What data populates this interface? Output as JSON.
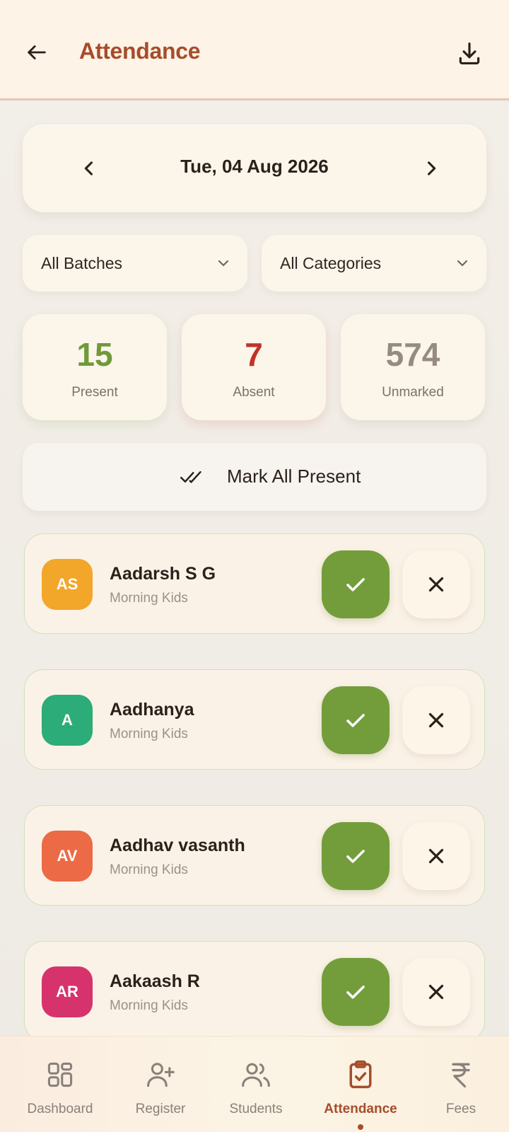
{
  "header": {
    "title": "Attendance"
  },
  "date_selector": {
    "date": "Tue, 04 Aug 2026"
  },
  "filters": {
    "batch": "All Batches",
    "category": "All Categories"
  },
  "stats": {
    "present": {
      "count": "15",
      "label": "Present"
    },
    "absent": {
      "count": "7",
      "label": "Absent"
    },
    "unmarked": {
      "count": "574",
      "label": "Unmarked"
    }
  },
  "mark_all": {
    "label": "Mark All Present"
  },
  "students": [
    {
      "initials": "AS",
      "name": "Aadarsh S G",
      "batch": "Morning Kids",
      "avatar_color": "#f2a62a",
      "status": "present"
    },
    {
      "initials": "A",
      "name": "Aadhanya",
      "batch": "Morning Kids",
      "avatar_color": "#2bac78",
      "status": "present"
    },
    {
      "initials": "AV",
      "name": "Aadhav vasanth",
      "batch": "Morning Kids",
      "avatar_color": "#ec6a45",
      "status": "present"
    },
    {
      "initials": "AR",
      "name": "Aakaash R",
      "batch": "Morning Kids",
      "avatar_color": "#d6336c",
      "status": "present"
    }
  ],
  "bottom_nav": {
    "items": [
      {
        "label": "Dashboard",
        "icon": "dashboard-grid-icon"
      },
      {
        "label": "Register",
        "icon": "user-plus-icon"
      },
      {
        "label": "Students",
        "icon": "users-icon"
      },
      {
        "label": "Attendance",
        "icon": "clipboard-check-icon",
        "active": true
      },
      {
        "label": "Fees",
        "icon": "rupee-icon"
      }
    ]
  },
  "colors": {
    "accent": "#a64d2c",
    "present_green": "#739d3b",
    "absent_red": "#c0322a",
    "header_bg": "#fdf3e6"
  }
}
